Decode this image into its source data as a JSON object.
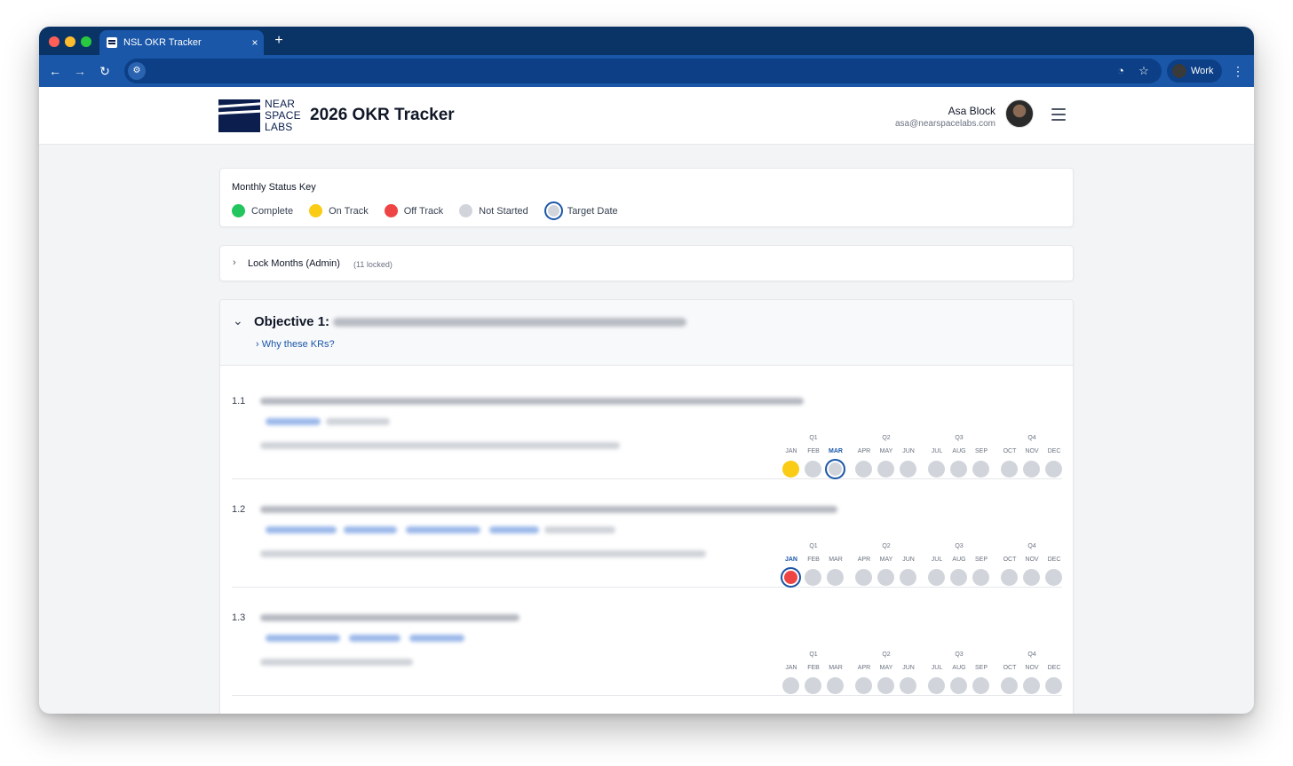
{
  "browser": {
    "tab_title": "NSL OKR Tracker",
    "tab_close": "×",
    "new_tab": "+",
    "profile_label": "Work"
  },
  "header": {
    "logo_lines": [
      "NEAR",
      "SPACE",
      "LABS"
    ],
    "title": "2026 OKR Tracker",
    "user_name": "Asa Block",
    "user_email": "asa@nearspacelabs.com"
  },
  "status_key": {
    "title": "Monthly Status Key",
    "items": [
      {
        "label": "Complete",
        "color": "#22c55e"
      },
      {
        "label": "On Track",
        "color": "#facc15"
      },
      {
        "label": "Off Track",
        "color": "#ef4444"
      },
      {
        "label": "Not Started",
        "color": "#d1d5db"
      },
      {
        "label": "Target Date",
        "color": "#1a57a8"
      }
    ]
  },
  "lock": {
    "label": "Lock Months (Admin)",
    "count": "(11 locked)"
  },
  "objective": {
    "label": "Objective 1:",
    "why_label": "Why these KRs?"
  },
  "quarters": [
    "Q1",
    "Q2",
    "Q3",
    "Q4"
  ],
  "months": [
    "JAN",
    "FEB",
    "MAR",
    "APR",
    "MAY",
    "JUN",
    "JUL",
    "AUG",
    "SEP",
    "OCT",
    "NOV",
    "DEC"
  ],
  "key_results": [
    {
      "number": "1.1",
      "statuses": [
        "on-track",
        "not-started",
        "not-started",
        "not-started",
        "not-started",
        "not-started",
        "not-started",
        "not-started",
        "not-started",
        "not-started",
        "not-started",
        "not-started"
      ],
      "active_month": 2,
      "target_month": 2
    },
    {
      "number": "1.2",
      "statuses": [
        "off-track",
        "not-started",
        "not-started",
        "not-started",
        "not-started",
        "not-started",
        "not-started",
        "not-started",
        "not-started",
        "not-started",
        "not-started",
        "not-started"
      ],
      "active_month": 0,
      "target_month": 0
    },
    {
      "number": "1.3",
      "statuses": [
        "not-started",
        "not-started",
        "not-started",
        "not-started",
        "not-started",
        "not-started",
        "not-started",
        "not-started",
        "not-started",
        "not-started",
        "not-started",
        "not-started"
      ],
      "active_month": -1,
      "target_month": -1
    }
  ],
  "colors": {
    "on-track": "#facc15",
    "off-track": "#ef4444",
    "not-started": "#d1d5db",
    "complete": "#22c55e",
    "accent": "#1a57a8"
  }
}
